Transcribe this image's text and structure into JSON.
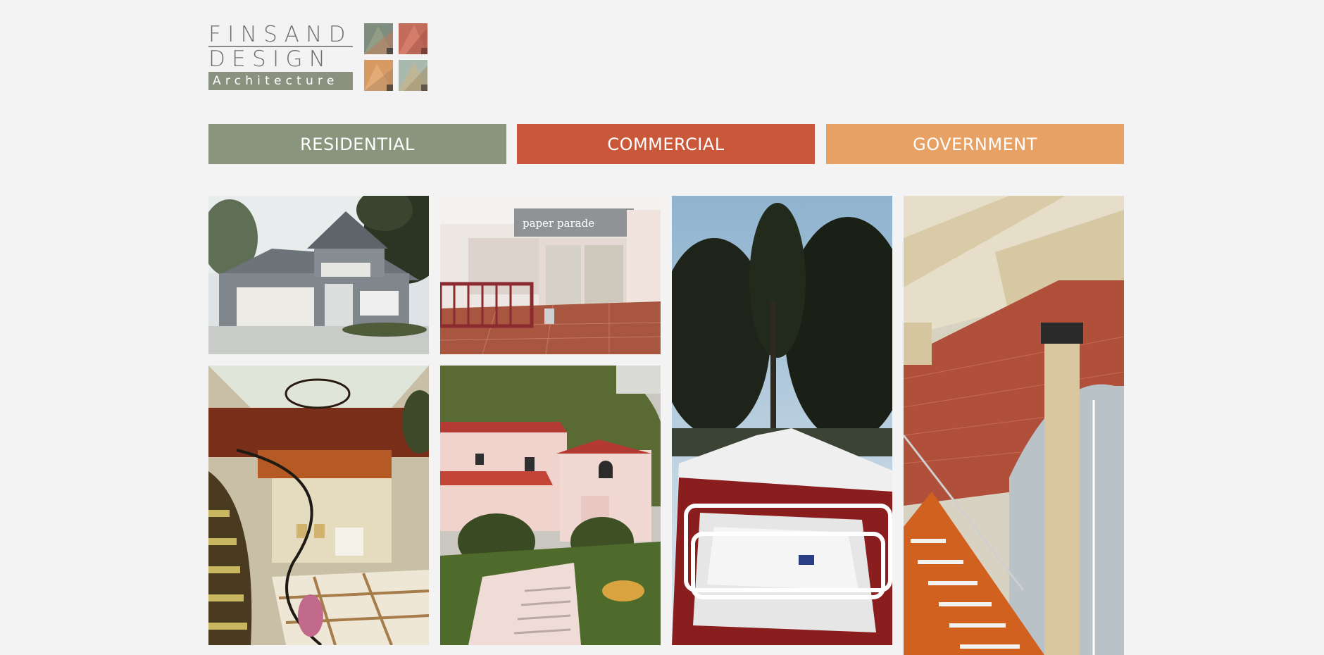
{
  "logo": {
    "line1": "FINSAND",
    "line2": "DESIGN",
    "tagline": "Architecture",
    "square_colors": [
      "#7e8d7d",
      "#c26c5c",
      "#d89a63",
      "#a9b9ad"
    ]
  },
  "categories": [
    {
      "label": "RESIDENTIAL",
      "color": "#8a957e"
    },
    {
      "label": "COMMERCIAL",
      "color": "#c9583a"
    },
    {
      "label": "GOVERNMENT",
      "color": "#e8a165"
    }
  ],
  "gallery": {
    "photos": [
      {
        "subject": "gray two-story house with garage"
      },
      {
        "subject": "retail storefront in shopping mall",
        "sign_text": "paper parade"
      },
      {
        "subject": "rooftop deck with skylight and cypress trees"
      },
      {
        "subject": "timber beams, brick wall and steel staircase"
      },
      {
        "subject": "grand foyer with curved staircase and chandelier"
      },
      {
        "subject": "pink stucco Mediterranean house on hillside"
      }
    ]
  }
}
